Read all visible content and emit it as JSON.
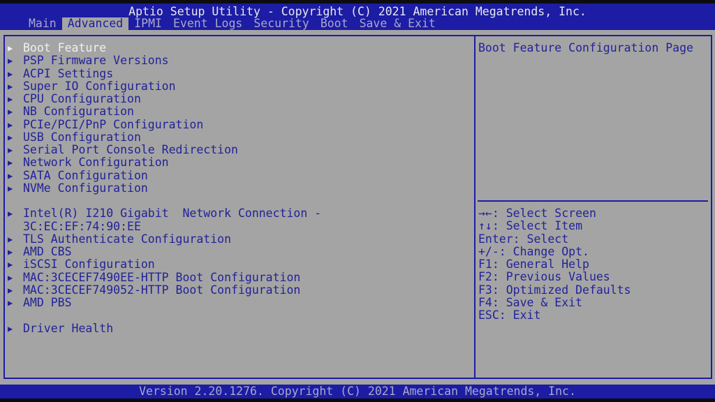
{
  "header": {
    "title": "Aptio Setup Utility - Copyright (C) 2021 American Megatrends, Inc."
  },
  "tabs": [
    "Main",
    "Advanced",
    "IPMI",
    "Event Logs",
    "Security",
    "Boot",
    "Save & Exit"
  ],
  "active_tab": "Advanced",
  "menu": [
    {
      "label": "Boot Feature",
      "arrow": true,
      "selected": true
    },
    {
      "label": "PSP Firmware Versions",
      "arrow": true
    },
    {
      "label": "ACPI Settings",
      "arrow": true
    },
    {
      "label": "Super IO Configuration",
      "arrow": true
    },
    {
      "label": "CPU Configuration",
      "arrow": true
    },
    {
      "label": "NB Configuration",
      "arrow": true
    },
    {
      "label": "PCIe/PCI/PnP Configuration",
      "arrow": true
    },
    {
      "label": "USB Configuration",
      "arrow": true
    },
    {
      "label": "Serial Port Console Redirection",
      "arrow": true
    },
    {
      "label": "Network Configuration",
      "arrow": true
    },
    {
      "label": "SATA Configuration",
      "arrow": true
    },
    {
      "label": "NVMe Configuration",
      "arrow": true
    },
    {
      "label": "",
      "arrow": false
    },
    {
      "label": "Intel(R) I210 Gigabit  Network Connection -",
      "arrow": true
    },
    {
      "label": "3C:EC:EF:74:90:EE",
      "arrow": false,
      "continuation": true
    },
    {
      "label": "TLS Authenticate Configuration",
      "arrow": true
    },
    {
      "label": "AMD CBS",
      "arrow": true
    },
    {
      "label": "iSCSI Configuration",
      "arrow": true
    },
    {
      "label": "MAC:3CECEF7490EE-HTTP Boot Configuration",
      "arrow": true
    },
    {
      "label": "MAC:3CECEF749052-HTTP Boot Configuration",
      "arrow": true
    },
    {
      "label": "AMD PBS",
      "arrow": true
    },
    {
      "label": "",
      "arrow": false
    },
    {
      "label": "Driver Health",
      "arrow": true
    }
  ],
  "help_text": "Boot Feature Configuration Page",
  "keys": [
    "→←: Select Screen",
    "↑↓: Select Item",
    "Enter: Select",
    "+/-: Change Opt.",
    "F1: General Help",
    "F2: Previous Values",
    "F3: Optimized Defaults",
    "F4: Save & Exit",
    "ESC: Exit"
  ],
  "footer": "Version 2.20.1276. Copyright (C) 2021 American Megatrends, Inc.",
  "colors": {
    "blue": "#1c1ca4",
    "gray": "#a4a4a4",
    "text": "#22229a"
  }
}
